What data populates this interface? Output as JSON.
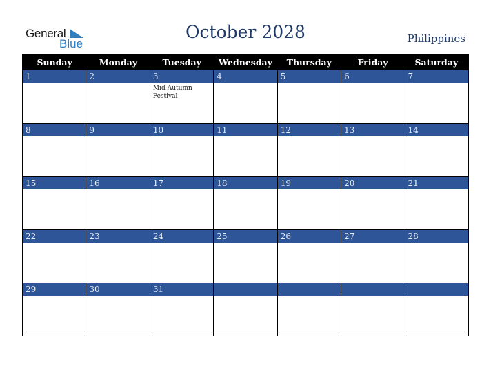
{
  "brand": {
    "word1": "General",
    "word2": "Blue"
  },
  "title": "October 2028",
  "country": "Philippines",
  "weekdays": [
    "Sunday",
    "Monday",
    "Tuesday",
    "Wednesday",
    "Thursday",
    "Friday",
    "Saturday"
  ],
  "weeks": [
    [
      {
        "n": "1",
        "e": ""
      },
      {
        "n": "2",
        "e": ""
      },
      {
        "n": "3",
        "e": "Mid-Autumn Festival"
      },
      {
        "n": "4",
        "e": ""
      },
      {
        "n": "5",
        "e": ""
      },
      {
        "n": "6",
        "e": ""
      },
      {
        "n": "7",
        "e": ""
      }
    ],
    [
      {
        "n": "8",
        "e": ""
      },
      {
        "n": "9",
        "e": ""
      },
      {
        "n": "10",
        "e": ""
      },
      {
        "n": "11",
        "e": ""
      },
      {
        "n": "12",
        "e": ""
      },
      {
        "n": "13",
        "e": ""
      },
      {
        "n": "14",
        "e": ""
      }
    ],
    [
      {
        "n": "15",
        "e": ""
      },
      {
        "n": "16",
        "e": ""
      },
      {
        "n": "17",
        "e": ""
      },
      {
        "n": "18",
        "e": ""
      },
      {
        "n": "19",
        "e": ""
      },
      {
        "n": "20",
        "e": ""
      },
      {
        "n": "21",
        "e": ""
      }
    ],
    [
      {
        "n": "22",
        "e": ""
      },
      {
        "n": "23",
        "e": ""
      },
      {
        "n": "24",
        "e": ""
      },
      {
        "n": "25",
        "e": ""
      },
      {
        "n": "26",
        "e": ""
      },
      {
        "n": "27",
        "e": ""
      },
      {
        "n": "28",
        "e": ""
      }
    ],
    [
      {
        "n": "29",
        "e": ""
      },
      {
        "n": "30",
        "e": ""
      },
      {
        "n": "31",
        "e": ""
      },
      {
        "n": "",
        "e": ""
      },
      {
        "n": "",
        "e": ""
      },
      {
        "n": "",
        "e": ""
      },
      {
        "n": "",
        "e": ""
      }
    ]
  ]
}
